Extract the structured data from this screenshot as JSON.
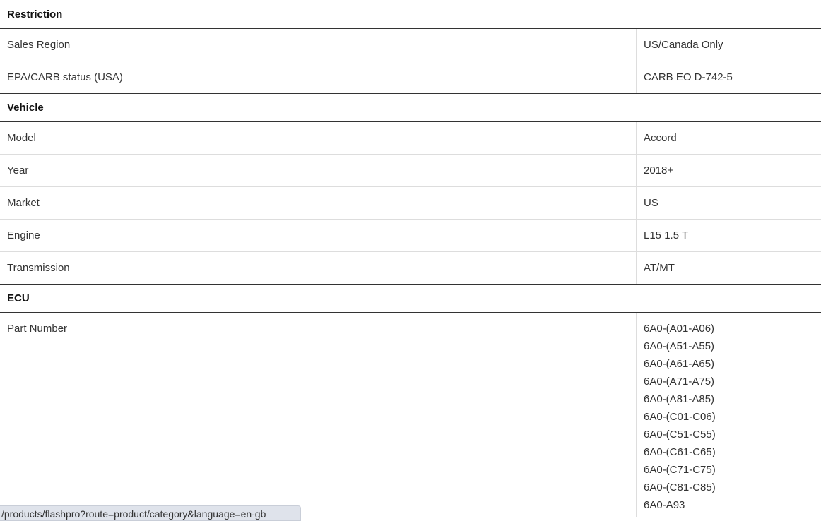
{
  "sections": {
    "restriction": {
      "title": "Restriction",
      "rows": [
        {
          "label": "Sales Region",
          "value": "US/Canada Only"
        },
        {
          "label": "EPA/CARB status (USA)",
          "value": "CARB EO D-742-5"
        }
      ]
    },
    "vehicle": {
      "title": "Vehicle",
      "rows": [
        {
          "label": "Model",
          "value": "Accord"
        },
        {
          "label": "Year",
          "value": "2018+"
        },
        {
          "label": "Market",
          "value": "US"
        },
        {
          "label": "Engine",
          "value": "L15 1.5 T"
        },
        {
          "label": "Transmission",
          "value": "AT/MT"
        }
      ]
    },
    "ecu": {
      "title": "ECU",
      "part_number_label": "Part Number",
      "part_numbers": [
        "6A0-(A01-A06)",
        "6A0-(A51-A55)",
        "6A0-(A61-A65)",
        "6A0-(A71-A75)",
        "6A0-(A81-A85)",
        "6A0-(C01-C06)",
        "6A0-(C51-C55)",
        "6A0-(C61-C65)",
        "6A0-(C71-C75)",
        "6A0-(C81-C85)",
        "6A0-A93"
      ]
    }
  },
  "status_bar": {
    "url": "/products/flashpro?route=product/category&language=en-gb"
  }
}
